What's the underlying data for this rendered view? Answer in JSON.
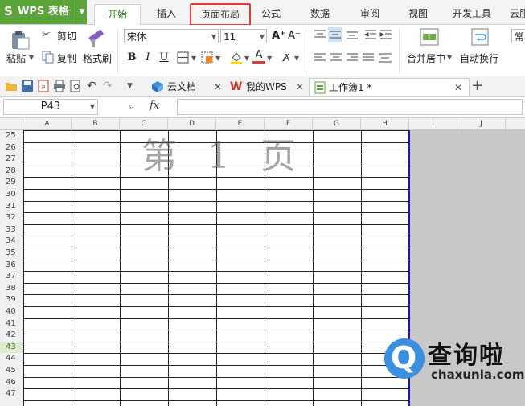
{
  "app": {
    "name": "WPS 表格",
    "logo": "S"
  },
  "menu": {
    "tabs": [
      "开始",
      "插入",
      "页面布局",
      "公式",
      "数据",
      "审阅",
      "视图",
      "开发工具",
      "云服"
    ],
    "active_index": 0,
    "highlighted_index": 2
  },
  "ribbon": {
    "paste": "粘贴",
    "cut": "剪切",
    "copy": "复制",
    "format_painter": "格式刷",
    "font_name": "宋体",
    "font_size": "11",
    "bold": "B",
    "italic": "I",
    "underline": "U",
    "merge_center": "合并居中",
    "wrap_text": "自动换行",
    "number_format": "常"
  },
  "quick_access": {
    "doc_tabs": [
      "云文档",
      "我的WPS",
      "工作簿1 *"
    ],
    "active_tab": 2
  },
  "formula_bar": {
    "cell_ref": "P43",
    "fx": "fx",
    "value": ""
  },
  "sheet": {
    "columns": [
      "A",
      "B",
      "C",
      "D",
      "E",
      "F",
      "G",
      "H",
      "I",
      "J"
    ],
    "rows": [
      "25",
      "26",
      "27",
      "28",
      "29",
      "30",
      "31",
      "32",
      "33",
      "34",
      "35",
      "36",
      "37",
      "38",
      "39",
      "40",
      "41",
      "42",
      "43",
      "44",
      "45",
      "46",
      "47"
    ],
    "selected_row": "43",
    "watermark": "第 1 页"
  },
  "site_logo": {
    "brand": "查询啦",
    "domain": "chaxunla.com"
  },
  "colors": {
    "wps_green": "#5aa43a",
    "highlight_red": "#e53935",
    "page_break": "#1a1aa8",
    "logo_blue": "#3a8fe0"
  }
}
